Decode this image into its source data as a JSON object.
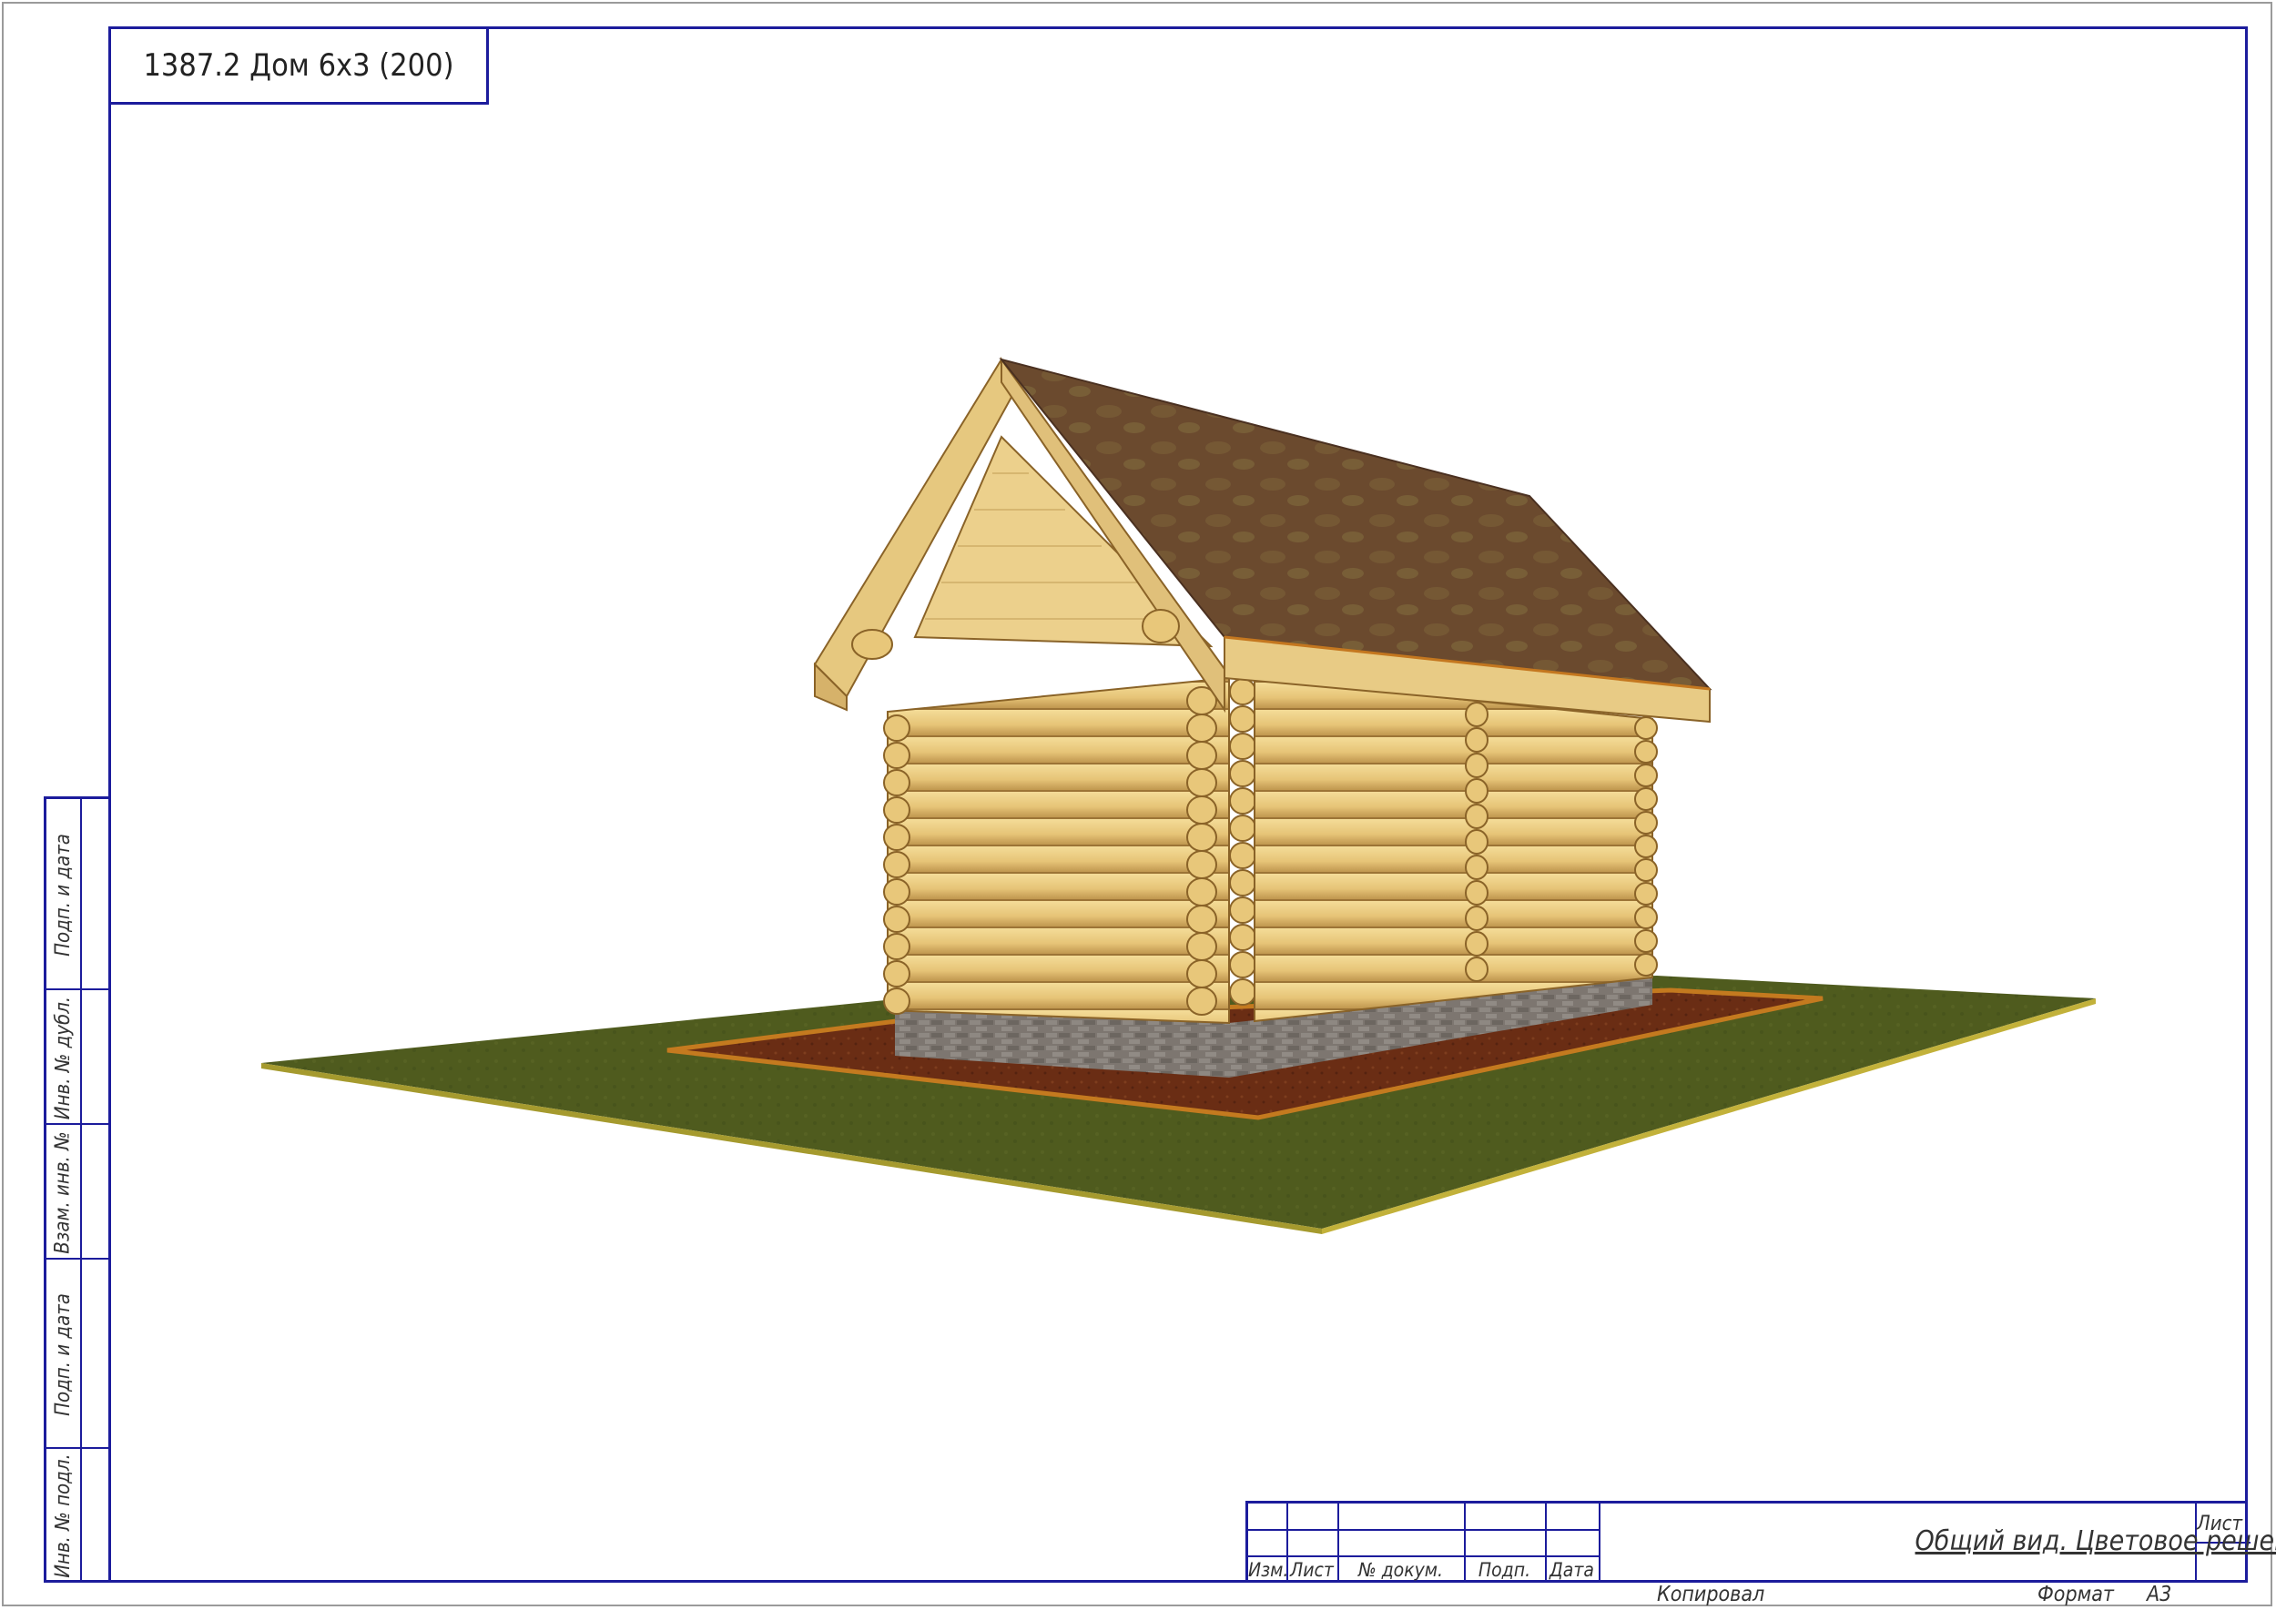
{
  "title_block": {
    "project_title": "1387.2 Дом 6х3 (200)"
  },
  "side_stamp": {
    "labels": [
      "Подп. и дата",
      "Инв. № дубл.",
      "Взам. инв. №",
      "Подп. и дата",
      "Инв. № подл."
    ]
  },
  "stamp": {
    "columns": [
      "Изм.",
      "Лист",
      "№ докум.",
      "Подп.",
      "Дата"
    ],
    "sheet_name": "Общий вид. Цветовое решение.",
    "sheet_label": "Лист"
  },
  "footer": {
    "copied_label": "Копировал",
    "format_label": "Формат",
    "format_value": "А3"
  },
  "colors": {
    "frame": "#1c1c9c",
    "logs": "#e8c77a",
    "roof": "#6b4a2e",
    "grass": "#4f5b1e",
    "soil": "#6a2d14",
    "plinth": "#7d7670"
  }
}
